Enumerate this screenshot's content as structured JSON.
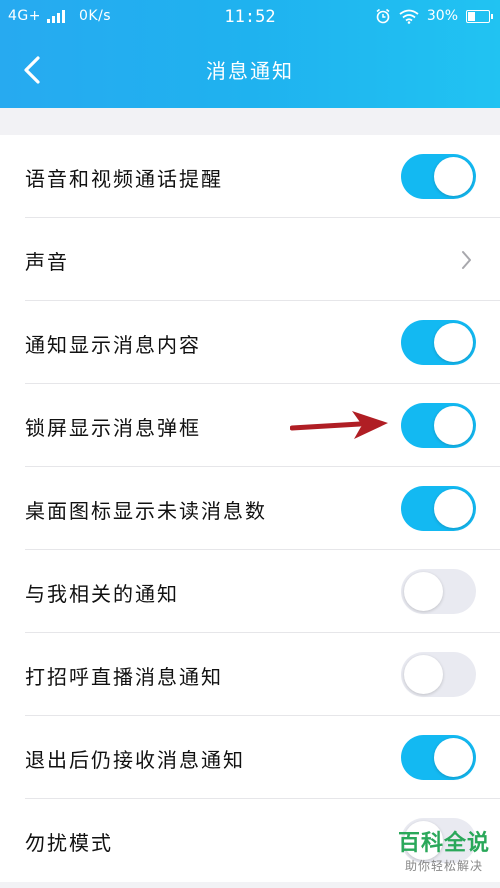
{
  "status_bar": {
    "network": "4G+",
    "speed": "0K/s",
    "time": "11:52",
    "battery": "30%",
    "battery_level": 0.3
  },
  "header": {
    "title": "消息通知",
    "back_icon": "chevron-left-icon"
  },
  "settings": [
    {
      "label": "语音和视频通话提醒",
      "control": "toggle",
      "on": true
    },
    {
      "label": "声音",
      "control": "chevron"
    },
    {
      "label": "通知显示消息内容",
      "control": "toggle",
      "on": true
    },
    {
      "label": "锁屏显示消息弹框",
      "control": "toggle",
      "on": true
    },
    {
      "label": "桌面图标显示未读消息数",
      "control": "toggle",
      "on": true
    },
    {
      "label": "与我相关的通知",
      "control": "toggle",
      "on": false
    },
    {
      "label": "打招呼直播消息通知",
      "control": "toggle",
      "on": false
    },
    {
      "label": "退出后仍接收消息通知",
      "control": "toggle",
      "on": true
    },
    {
      "label": "勿扰模式",
      "control": "toggle",
      "on": false
    }
  ],
  "watermark": {
    "title": "百科全说",
    "subtitle": "助你轻松解决"
  },
  "colors": {
    "header": "#1fb2ef",
    "toggle_on": "#13b9f2",
    "toggle_off": "#e9eaf1",
    "arrow": "#b01e24"
  }
}
